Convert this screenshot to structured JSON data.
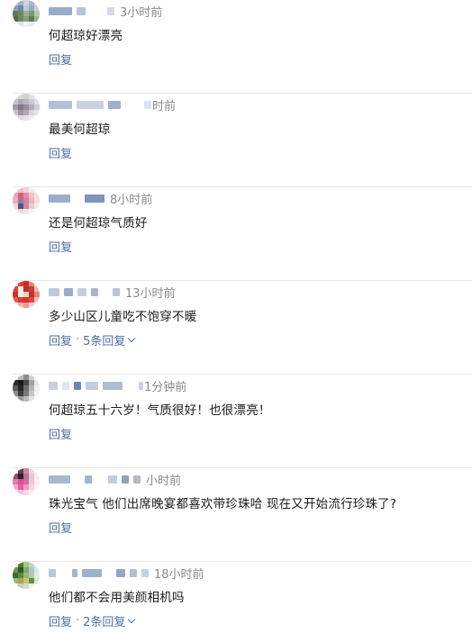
{
  "comments": [
    {
      "time": "3小时前",
      "text": "何超琼好漂亮",
      "reply_label": "回复",
      "replies_label": ""
    },
    {
      "time": "时前",
      "text": "最美何超琼",
      "reply_label": "回复",
      "replies_label": ""
    },
    {
      "time": "8小时前",
      "text": "还是何超琼气质好",
      "reply_label": "回复",
      "replies_label": ""
    },
    {
      "time": "13小时前",
      "text": "多少山区儿童吃不饱穿不暖",
      "reply_label": "回复",
      "replies_label": "5条回复"
    },
    {
      "time": "1分钟前",
      "text": "何超琼五十六岁！气质很好！也很漂亮！",
      "reply_label": "回复",
      "replies_label": ""
    },
    {
      "time": "小时前",
      "text": "珠光宝气 他们出席晚宴都喜欢带珍珠哈 现在又开始流行珍珠了?",
      "reply_label": "回复",
      "replies_label": ""
    },
    {
      "time": "18小时前",
      "text": "他们都不会用美颜相机吗",
      "reply_label": "回复",
      "replies_label": "2条回复"
    }
  ],
  "separator": "·",
  "colors": {
    "link": "#4a6fa5",
    "time": "#8a8a8a",
    "divider": "#e8e8e8"
  },
  "icons": {
    "expand": "chevron-down-icon"
  }
}
